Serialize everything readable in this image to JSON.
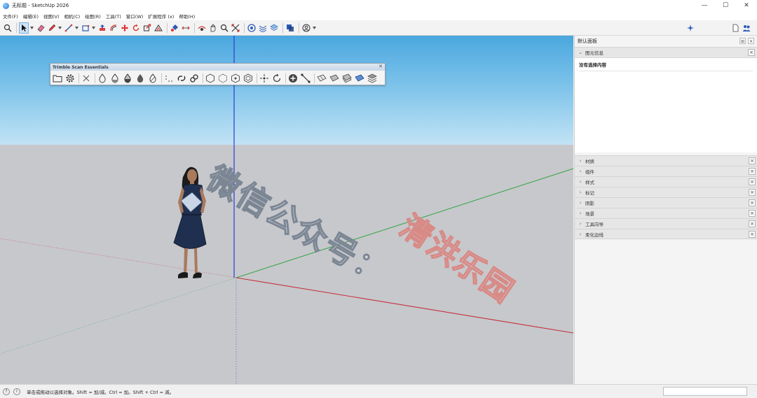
{
  "window": {
    "title": "无标题 - SketchUp 2026",
    "minimize": "—",
    "maximize": "☐",
    "close": "✕"
  },
  "menu": [
    "文件(F)",
    "编辑(E)",
    "视图(V)",
    "相机(C)",
    "绘图(R)",
    "工具(T)",
    "窗口(W)",
    "扩展程序 (x)",
    "帮助(H)"
  ],
  "floating_toolbar": {
    "title": "Trimble Scan Essentials",
    "close": "✕"
  },
  "watermark": {
    "line1": "微信公众号：",
    "line2": "清洪乐园"
  },
  "panel": {
    "title": "默认面板",
    "entity_info": {
      "label": "图元信息",
      "empty_text": "没有选择内容"
    },
    "sections": [
      "材质",
      "组件",
      "样式",
      "标记",
      "阴影",
      "场景",
      "工具向导",
      "柔化边线"
    ]
  },
  "status": {
    "hint": "单击或拖动以选择对象。Shift = 加/减。Ctrl = 加。Shift + Ctrl = 减。"
  },
  "colors": {
    "sky_top": "#4aa7de",
    "ground": "#c7c8cc",
    "axis_red": "#c4303c",
    "axis_green": "#3aa64a",
    "axis_blue": "#2a3bd6"
  }
}
